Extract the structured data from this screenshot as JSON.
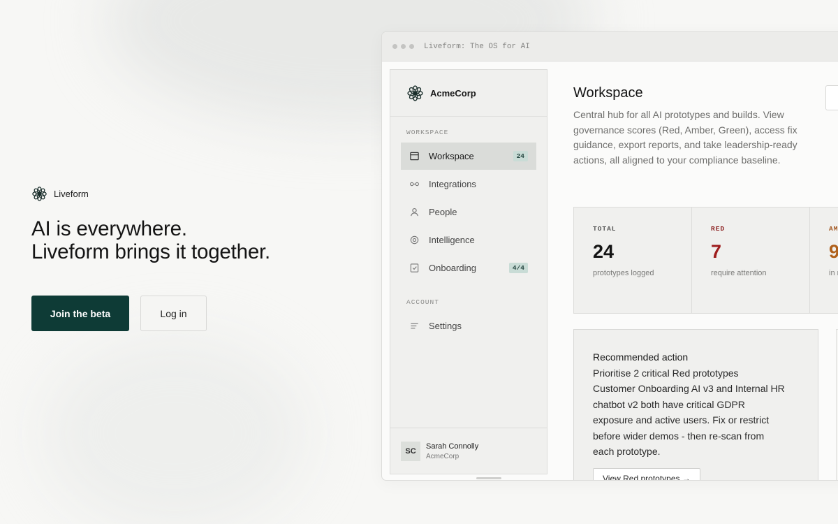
{
  "hero": {
    "brand": "Liveform",
    "headline_line1": "AI is everywhere.",
    "headline_line2": "Liveform brings it together.",
    "primary_cta": "Join the beta",
    "secondary_cta": "Log in"
  },
  "window": {
    "title": "Liveform: The OS for AI"
  },
  "sidebar": {
    "org_name": "AcmeCorp",
    "workspace_section": "WORKSPACE",
    "account_section": "ACCOUNT",
    "items": [
      {
        "label": "Workspace",
        "badge": "24",
        "icon": "window-icon"
      },
      {
        "label": "Integrations",
        "icon": "link-icon"
      },
      {
        "label": "People",
        "icon": "person-icon"
      },
      {
        "label": "Intelligence",
        "icon": "target-icon"
      },
      {
        "label": "Onboarding",
        "badge": "4/4",
        "icon": "checklist-icon"
      }
    ],
    "account_items": [
      {
        "label": "Settings",
        "icon": "menu-lines-icon"
      }
    ],
    "user": {
      "initials": "SC",
      "name": "Sarah Connolly",
      "org": "AcmeCorp"
    }
  },
  "main": {
    "title": "Workspace",
    "description": "Central hub for all AI prototypes and builds. View governance scores (Red, Amber, Green), access fix guidance, export reports, and take leadership-ready actions, all aligned to your compliance baseline.",
    "stats": [
      {
        "label": "TOTAL",
        "value": "24",
        "sub": "prototypes logged"
      },
      {
        "label": "RED",
        "value": "7",
        "sub": "require attention"
      },
      {
        "label": "AM",
        "value": "9",
        "sub": "in r"
      }
    ],
    "recommendation": {
      "title": "Recommended action",
      "heading": "Prioritise 2 critical Red prototypes",
      "lines": [
        "Customer Onboarding AI v3 and Internal HR",
        "chatbot v2 both have critical GDPR",
        "exposure and active users. Fix or restrict",
        "before wider demos - then re-scan from",
        "each prototype."
      ],
      "button": "View Red prototypes →"
    }
  },
  "colors": {
    "primary": "#0e3b36",
    "red": "#9e1d1d",
    "amber": "#b0601a",
    "badge_bg": "#c9dcd6"
  }
}
